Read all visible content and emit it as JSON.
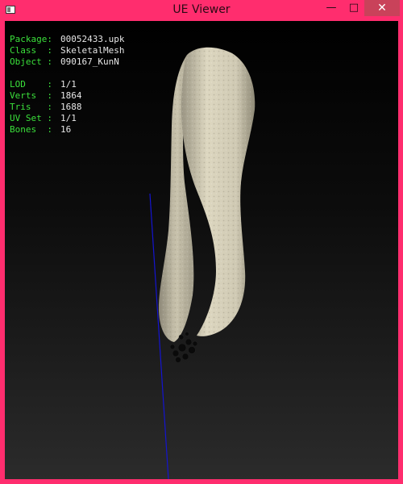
{
  "window": {
    "title": "UE Viewer",
    "min_glyph": "—",
    "max_glyph": "□",
    "close_glyph": "✕",
    "app_icon": "app-window-icon",
    "accent_color": "#ff2d6e"
  },
  "hud": {
    "group1": [
      {
        "label": "Package:",
        "value": "00052433.upk"
      },
      {
        "label": "Class  :",
        "value": "SkeletalMesh"
      },
      {
        "label": "Object :",
        "value": "090167_KunN"
      }
    ],
    "group2": [
      {
        "label": "LOD    :",
        "value": "1/1"
      },
      {
        "label": "Verts  :",
        "value": "1864"
      },
      {
        "label": "Tris   :",
        "value": "1688"
      },
      {
        "label": "UV Set :",
        "value": "1/1"
      },
      {
        "label": "Bones  :",
        "value": "16"
      }
    ],
    "label_color": "#3be03b",
    "value_color": "#e6e6e6"
  },
  "scene": {
    "axis_color": "#1414d0",
    "mesh_color": "#cfc9b4"
  }
}
